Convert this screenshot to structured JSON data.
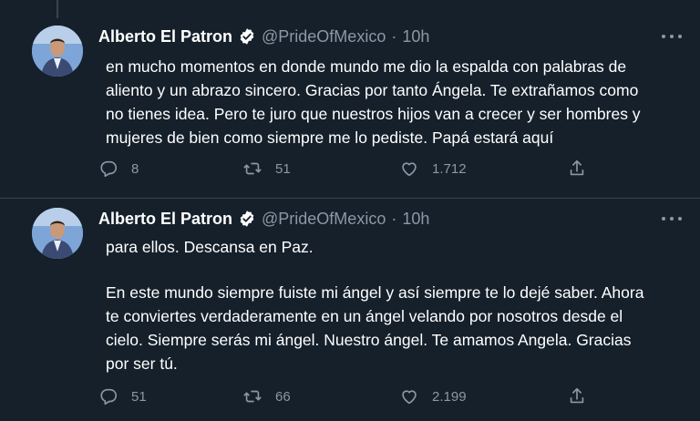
{
  "tweets": [
    {
      "author_name": "Alberto El Patron",
      "handle": "@PrideOfMexico",
      "separator": "·",
      "time": "10h",
      "paragraphs": [
        "en mucho momentos en donde mundo me dio la espalda con palabras de aliento y un abrazo sincero. Gracias por tanto Ángela. Te extrañamos como no tienes idea. Pero te juro que nuestros hijos van a crecer y ser hombres y mujeres de bien como siempre me lo pediste. Papá estará aquí"
      ],
      "replies": "8",
      "retweets": "51",
      "likes": "1.712"
    },
    {
      "author_name": "Alberto El Patron",
      "handle": "@PrideOfMexico",
      "separator": "·",
      "time": "10h",
      "paragraphs": [
        "para ellos. Descansa en Paz.",
        "En este mundo siempre fuiste mi ángel y así siempre te lo dejé saber. Ahora te conviertes verdaderamente en un ángel velando por nosotros desde el cielo. Siempre serás mi ángel. Nuestro ángel. Te amamos Angela. Gracias por ser tú."
      ],
      "replies": "51",
      "retweets": "66",
      "likes": "2.199"
    }
  ],
  "colors": {
    "background": "#15202b",
    "text": "#ffffff",
    "muted": "#8b98a5",
    "verified": "#ffffff",
    "border": "#38444d"
  },
  "icons": [
    "more-icon",
    "verified-badge-icon",
    "reply-icon",
    "retweet-icon",
    "like-icon",
    "share-icon"
  ]
}
